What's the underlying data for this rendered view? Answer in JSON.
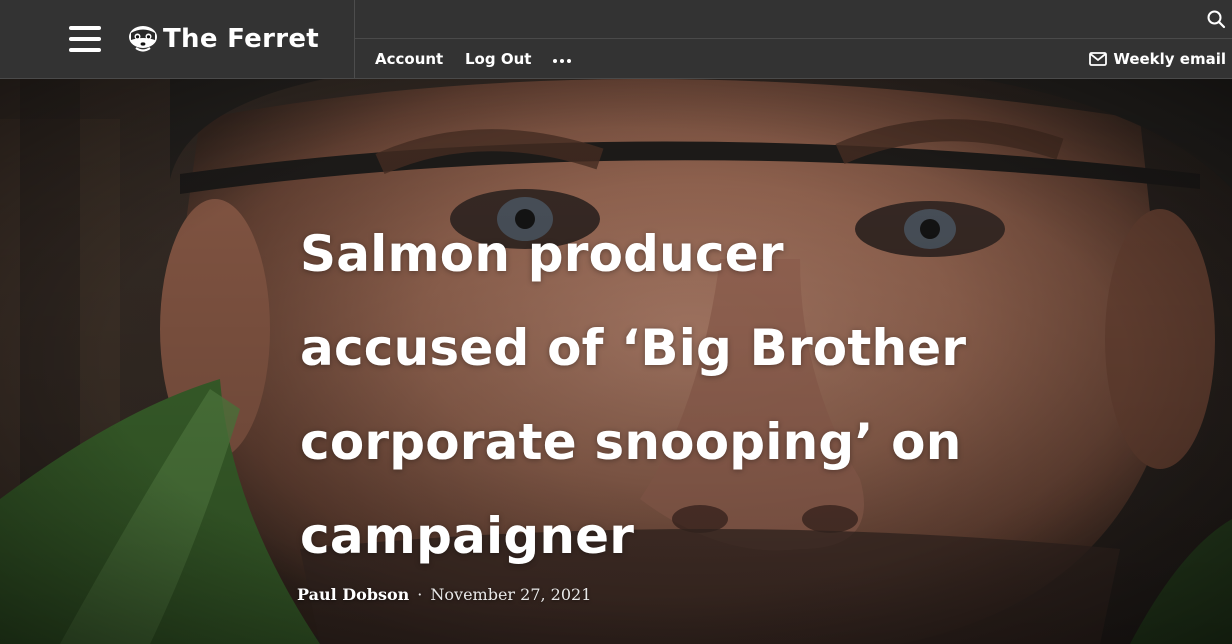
{
  "site": {
    "name": "The Ferret"
  },
  "nav": {
    "account_label": "Account",
    "logout_label": "Log Out",
    "weekly_email_label": "Weekly email"
  },
  "icons": {
    "menu": "hamburger-menu-icon",
    "logo": "ferret-logo-icon",
    "search": "search-icon",
    "more": "more-dots-icon",
    "mail": "mail-icon"
  },
  "article": {
    "headline": "Salmon producer accused of ‘Big Brother corporate snooping’ on campaigner",
    "author": "Paul Dobson",
    "separator": "·",
    "date": "November 27, 2021"
  },
  "colors": {
    "header_bg": "#333333",
    "text": "#ffffff"
  }
}
